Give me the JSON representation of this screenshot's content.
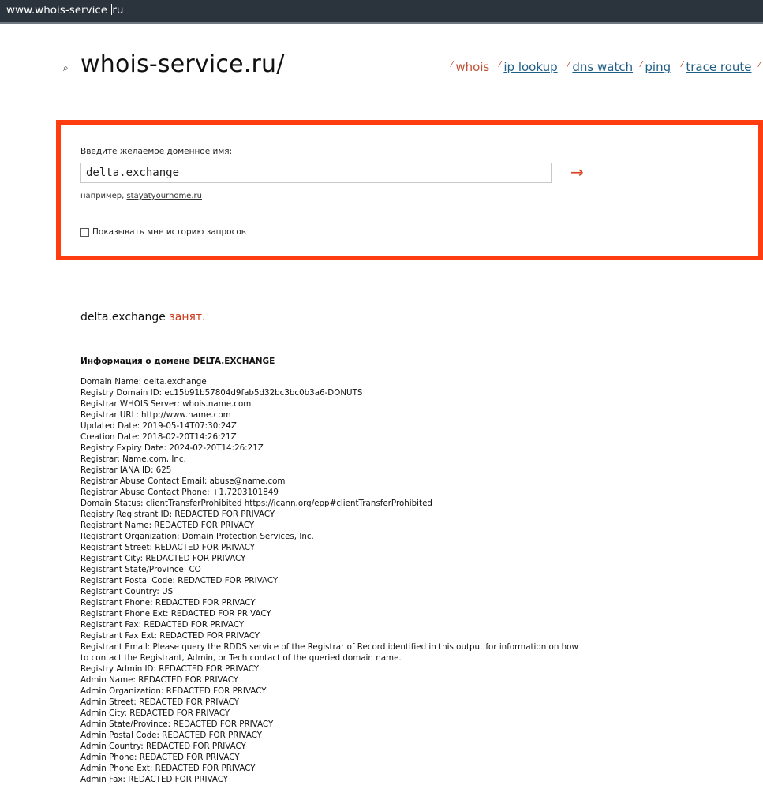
{
  "browser": {
    "url_before_caret": "www.whois-service ",
    "url_after_caret": "ru"
  },
  "header": {
    "logo_icon": "magnifier-icon",
    "logo_text": "whois-service.ru/",
    "nav": [
      {
        "tick": "/",
        "label": "whois",
        "active": true
      },
      {
        "tick": "/",
        "label": "ip lookup",
        "active": false
      },
      {
        "tick": "/",
        "label": "dns watch",
        "active": false
      },
      {
        "tick": "/",
        "label": "ping",
        "active": false
      },
      {
        "tick": "/",
        "label": "trace route",
        "active": false
      },
      {
        "tick": "/",
        "label": "",
        "active": false
      }
    ]
  },
  "form": {
    "label": "Введите желаемое доменное имя:",
    "input_value": "delta.exchange",
    "submit_glyph": "→",
    "example_prefix": "например, ",
    "example_link": "stayatyourhome.ru",
    "history_label": "Показывать мне историю запросов",
    "history_checked": false
  },
  "result": {
    "domain": "delta.exchange",
    "status": "занят.",
    "info_title": "Информация о домене DELTA.EXCHANGE",
    "lines": [
      "Domain Name: delta.exchange",
      "Registry Domain ID: ec15b91b57804d9fab5d32bc3bc0b3a6-DONUTS",
      "Registrar WHOIS Server: whois.name.com",
      "Registrar URL: http://www.name.com",
      "Updated Date: 2019-05-14T07:30:24Z",
      "Creation Date: 2018-02-20T14:26:21Z",
      "Registry Expiry Date: 2024-02-20T14:26:21Z",
      "Registrar: Name.com, Inc.",
      "Registrar IANA ID: 625",
      "Registrar Abuse Contact Email: abuse@name.com",
      "Registrar Abuse Contact Phone: +1.7203101849",
      "Domain Status: clientTransferProhibited https://icann.org/epp#clientTransferProhibited",
      "Registry Registrant ID: REDACTED FOR PRIVACY",
      "Registrant Name: REDACTED FOR PRIVACY",
      "Registrant Organization: Domain Protection Services, Inc.",
      "Registrant Street: REDACTED FOR PRIVACY",
      "Registrant City: REDACTED FOR PRIVACY",
      "Registrant State/Province: CO",
      "Registrant Postal Code: REDACTED FOR PRIVACY",
      "Registrant Country: US",
      "Registrant Phone: REDACTED FOR PRIVACY",
      "Registrant Phone Ext: REDACTED FOR PRIVACY",
      "Registrant Fax: REDACTED FOR PRIVACY",
      "Registrant Fax Ext: REDACTED FOR PRIVACY",
      "Registrant Email: Please query the RDDS service of the Registrar of Record identified in this output for information on how to contact the Registrant, Admin, or Tech contact of the queried domain name.",
      "Registry Admin ID: REDACTED FOR PRIVACY",
      "Admin Name: REDACTED FOR PRIVACY",
      "Admin Organization: REDACTED FOR PRIVACY",
      "Admin Street: REDACTED FOR PRIVACY",
      "Admin City: REDACTED FOR PRIVACY",
      "Admin State/Province: REDACTED FOR PRIVACY",
      "Admin Postal Code: REDACTED FOR PRIVACY",
      "Admin Country: REDACTED FOR PRIVACY",
      "Admin Phone: REDACTED FOR PRIVACY",
      "Admin Phone Ext: REDACTED FOR PRIVACY",
      "Admin Fax: REDACTED FOR PRIVACY"
    ]
  },
  "colors": {
    "accent_red": "#ff3d10",
    "taken_red": "#cc3b1e",
    "link_blue": "#1f5e86",
    "address_bar": "#2b333d"
  }
}
